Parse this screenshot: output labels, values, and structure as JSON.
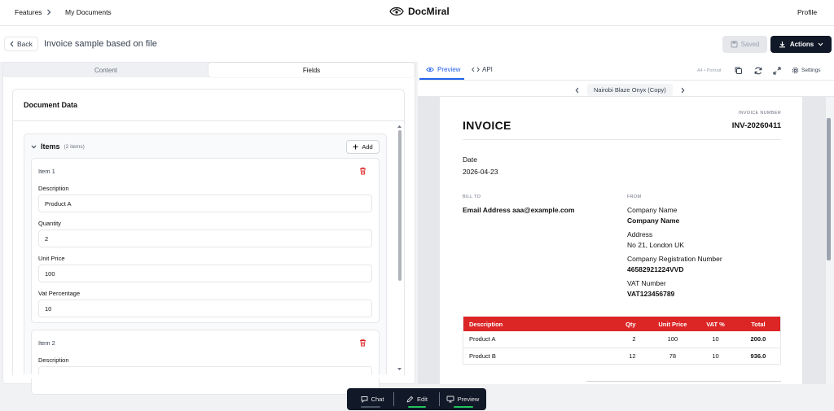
{
  "topnav": {
    "features": "Features",
    "my_documents": "My Documents",
    "brand": "DocMiral",
    "profile": "Profile"
  },
  "header": {
    "back": "Back",
    "title": "Invoice sample based on file",
    "saved": "Saved",
    "actions": "Actions"
  },
  "left": {
    "tabs": [
      "Content",
      "Fields"
    ],
    "active_tab": "Fields",
    "section_title": "Document Data",
    "items_title": "Items",
    "items_count": "(2 items)",
    "add_label": "Add",
    "items": [
      {
        "title": "Item 1",
        "fields": [
          {
            "label": "Description",
            "value": "Product A"
          },
          {
            "label": "Quantity",
            "value": "2"
          },
          {
            "label": "Unit Price",
            "value": "100"
          },
          {
            "label": "Vat Percentage",
            "value": "10"
          }
        ]
      },
      {
        "title": "Item 2",
        "fields": [
          {
            "label": "Description",
            "value": ""
          }
        ]
      }
    ]
  },
  "right": {
    "tabs": {
      "preview": "Preview",
      "api": "API"
    },
    "a4_label": "A4 • Portrait",
    "settings": "Settings",
    "template_name": "Nairobi Blaze Onyx (Copy)"
  },
  "invoice": {
    "title": "INVOICE",
    "number_label": "INVOICE NUMBER",
    "number": "INV-20260411",
    "date_label": "Date",
    "date": "2026-04-23",
    "bill_to_label": "BILL TO",
    "bill_to": "Email Address aaa@example.com",
    "from_label": "FROM",
    "company_label": "Company Name",
    "company": "Company Name",
    "address_label": "Address",
    "address": "No 21, London UK",
    "reg_label": "Company Registration Number",
    "reg": "46582921224VVD",
    "vat_label": "VAT Number",
    "vat": "VAT123456789",
    "table": {
      "headers": [
        "Description",
        "Qty",
        "Unit Price",
        "VAT %",
        "Total"
      ],
      "rows": [
        [
          "Product A",
          "2",
          "100",
          "10",
          "200.0"
        ],
        [
          "Product B",
          "12",
          "78",
          "10",
          "936.0"
        ]
      ]
    },
    "accent_color": "#dc2626"
  },
  "bottom_toolbar": {
    "chat": "Chat",
    "edit": "Edit",
    "preview": "Preview"
  }
}
